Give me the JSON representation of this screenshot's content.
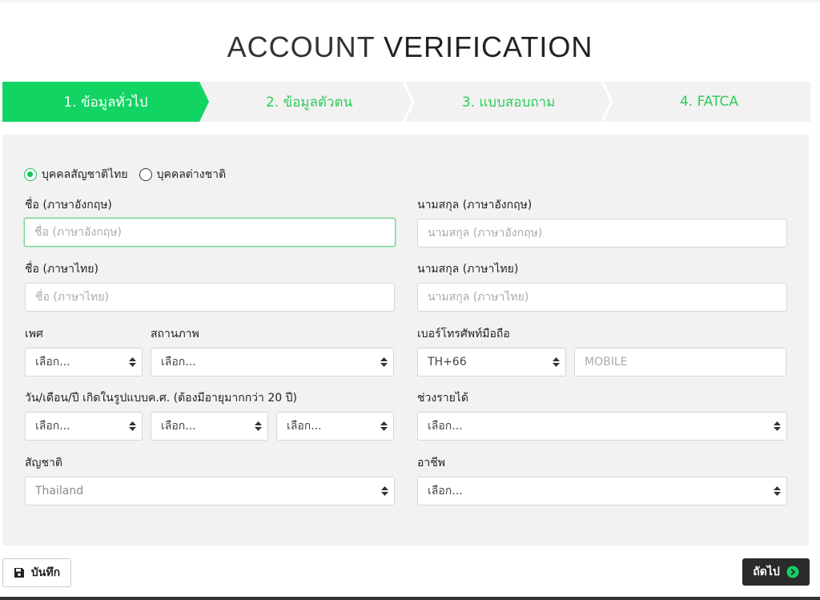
{
  "header": {
    "title_light": "ACCOUNT",
    "title_strong": "VERIFICATION"
  },
  "steps": [
    {
      "label": "1. ข้อมูลทั่วไป",
      "active": true
    },
    {
      "label": "2. ข้อมูลตัวตน",
      "active": false
    },
    {
      "label": "3. แบบสอบถาม",
      "active": false
    },
    {
      "label": "4. FATCA",
      "active": false
    }
  ],
  "nationality_type": {
    "options": [
      "บุคคลสัญชาติไทย",
      "บุคคลต่างชาติ"
    ],
    "selected": "บุคคลสัญชาติไทย"
  },
  "form": {
    "first_name_en": {
      "label": "ชื่อ (ภาษาอังกฤษ)",
      "placeholder": "ชื่อ (ภาษาอังกฤษ)"
    },
    "last_name_en": {
      "label": "นามสกุล (ภาษาอังกฤษ)",
      "placeholder": "นามสกุล (ภาษาอังกฤษ)"
    },
    "first_name_th": {
      "label": "ชื่อ (ภาษาไทย)",
      "placeholder": "ชื่อ (ภาษาไทย)"
    },
    "last_name_th": {
      "label": "นามสกุล (ภาษาไทย)",
      "placeholder": "นามสกุล (ภาษาไทย)"
    },
    "gender": {
      "label": "เพศ",
      "value": "เลือก..."
    },
    "status": {
      "label": "สถานภาพ",
      "value": "เลือก..."
    },
    "mobile": {
      "label": "เบอร์โทรศัพท์มือถือ",
      "country_code": "TH+66",
      "placeholder": "MOBILE"
    },
    "birthdate": {
      "label": "วัน/เดือน/ปี เกิดในรูปแบบค.ศ. (ต้องมีอายุมากกว่า 20 ปี)",
      "day": "เลือก...",
      "month": "เลือก...",
      "year": "เลือก..."
    },
    "income": {
      "label": "ช่วงรายได้",
      "value": "เลือก..."
    },
    "nationality": {
      "label": "สัญชาติ",
      "value": "Thailand"
    },
    "occupation": {
      "label": "อาชีพ",
      "value": "เลือก..."
    }
  },
  "footer": {
    "save_label": "บันทึก",
    "next_label": "ถัดไป"
  },
  "colors": {
    "accent": "#11d463",
    "panel": "#f2f2f2",
    "dark_button": "#2b2b2b"
  },
  "icons": {
    "save": "floppy-disk-icon",
    "next": "arrow-circle-right-icon",
    "select": "sort-arrows-icon"
  }
}
